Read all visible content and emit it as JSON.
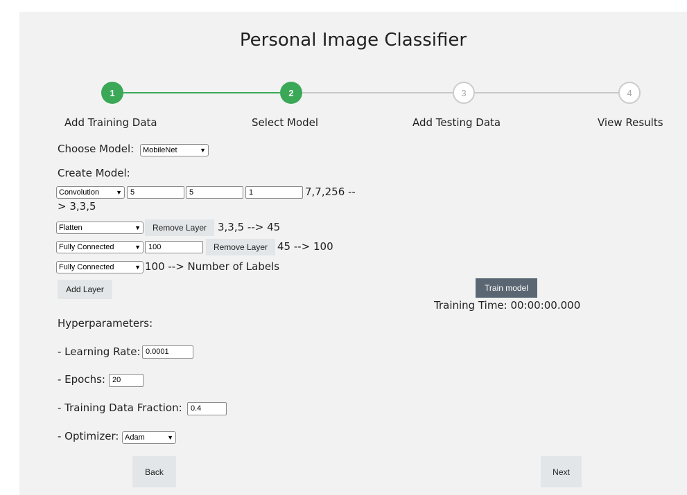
{
  "title": "Personal Image Classifier",
  "steps": [
    {
      "number": "1",
      "label": "Add Training Data",
      "status": "complete"
    },
    {
      "number": "2",
      "label": "Select Model",
      "status": "complete"
    },
    {
      "number": "3",
      "label": "Add Testing Data",
      "status": "incomplete"
    },
    {
      "number": "4",
      "label": "View Results",
      "status": "incomplete"
    }
  ],
  "colors": {
    "complete": "#3aa856",
    "incomplete": "#c8c8c8"
  },
  "choose_model": {
    "label": "Choose Model:",
    "value": "MobileNet"
  },
  "create_model": {
    "label": "Create Model:",
    "layers": [
      {
        "type": "Convolution",
        "inputs": [
          "5",
          "5",
          "1"
        ],
        "shape": "7,7,256 --",
        "shape_cont": "> 3,3,5"
      },
      {
        "type": "Flatten",
        "remove_label": "Remove Layer",
        "shape": "3,3,5 --> 45"
      },
      {
        "type": "Fully Connected",
        "input": "100",
        "remove_label": "Remove Layer",
        "shape": "45 --> 100"
      },
      {
        "type": "Fully Connected",
        "shape": "100 --> Number of Labels"
      }
    ],
    "add_layer_label": "Add Layer"
  },
  "hyperparameters": {
    "label": "Hyperparameters:",
    "learning_rate": {
      "label": "- Learning Rate:",
      "value": "0.0001"
    },
    "epochs": {
      "label": "- Epochs:",
      "value": "20"
    },
    "training_fraction": {
      "label": "- Training Data Fraction:",
      "value": "0.4"
    },
    "optimizer": {
      "label": "- Optimizer:",
      "value": "Adam"
    }
  },
  "train": {
    "button_label": "Train model",
    "time_text": "Training Time: 00:00:00.000"
  },
  "nav": {
    "back_label": "Back",
    "next_label": "Next"
  }
}
